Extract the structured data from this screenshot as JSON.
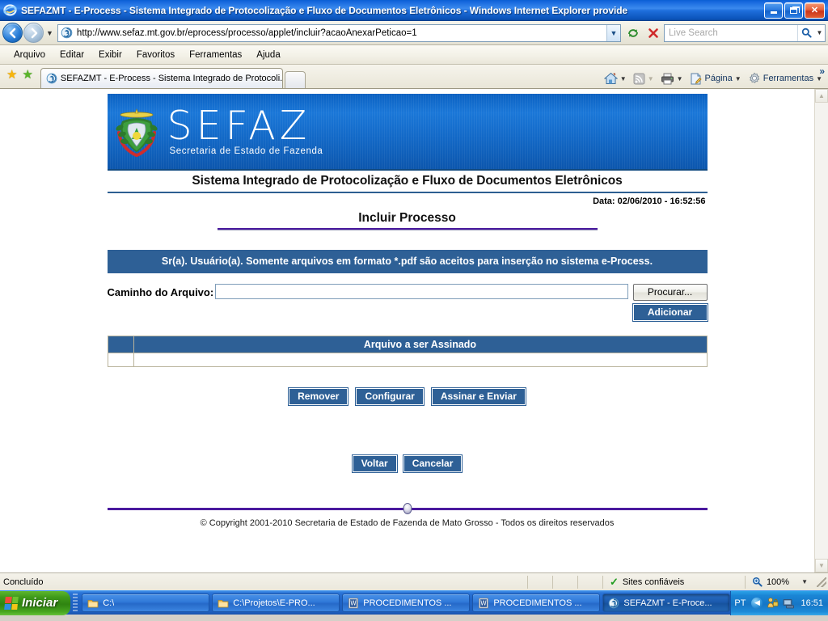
{
  "window": {
    "title": "SEFAZMT - E-Process - Sistema Integrado de Protocolização e Fluxo de Documentos Eletrônicos - Windows Internet Explorer provide",
    "minimize_label": "Minimizar",
    "maximize_label": "Restaurar",
    "close_label": "Fechar"
  },
  "navbar": {
    "back_label": "Voltar",
    "forward_label": "Avançar",
    "url": "http://www.sefaz.mt.gov.br/eprocess/processo/applet/incluir?acaoAnexarPeticao=1",
    "refresh_label": "Atualizar",
    "stop_label": "Parar",
    "search_placeholder": "Live Search",
    "search_value": ""
  },
  "menubar": {
    "items": [
      "Arquivo",
      "Editar",
      "Exibir",
      "Favoritos",
      "Ferramentas",
      "Ajuda"
    ]
  },
  "tabbar": {
    "tab_title": "SEFAZMT - E-Process - Sistema Integrado de Protocoli...",
    "new_tab_label": "Nova Guia",
    "tools": [
      {
        "label": "",
        "icon": "home-icon",
        "has_caret": true
      },
      {
        "label": "",
        "icon": "feeds-icon",
        "has_caret": true
      },
      {
        "label": "",
        "icon": "print-icon",
        "has_caret": true
      },
      {
        "label": "Página",
        "icon": "page-icon",
        "has_caret": true
      },
      {
        "label": "Ferramentas",
        "icon": "gear-icon",
        "has_caret": true
      }
    ],
    "overflow_label": "»"
  },
  "page": {
    "banner": {
      "brand": "SEFAZ",
      "tagline": "Secretaria de Estado de Fazenda",
      "crest_alt": "Brasão do Estado de Mato Grosso"
    },
    "system_title": "Sistema Integrado de Protocolização e Fluxo de Documentos Eletrônicos",
    "date_line": "Data: 02/06/2010 - 16:52:56",
    "page_title": "Incluir Processo",
    "notice": "Sr(a). Usuário(a). Somente arquivos em formato *.pdf são aceitos para inserção no sistema e-Process.",
    "form": {
      "file_path_label": "Caminho do Arquivo:",
      "file_path_value": "",
      "file_path_placeholder": "",
      "browse_label": "Procurar...",
      "add_label": "Adicionar"
    },
    "table": {
      "header_narrow": "",
      "header_main": "Arquivo a ser Assinado",
      "rows": [
        {
          "select": "",
          "filename": ""
        }
      ]
    },
    "actions": {
      "remove_label": "Remover",
      "configure_label": "Configurar",
      "sign_send_label": "Assinar e Enviar"
    },
    "nav_actions": {
      "back_label": "Voltar",
      "cancel_label": "Cancelar"
    },
    "copyright": "© Copyright 2001-2010 Secretaria de Estado de Fazenda de Mato Grosso - Todos os direitos reservados"
  },
  "statusbar": {
    "status": "Concluído",
    "zone": "Sites confiáveis",
    "zoom": "100%"
  },
  "taskbar": {
    "start_label": "Iniciar",
    "tasks": [
      {
        "label": "C:\\",
        "icon": "folder-icon",
        "active": false
      },
      {
        "label": "C:\\Projetos\\E-PRO...",
        "icon": "folder-icon",
        "active": false
      },
      {
        "label": "PROCEDIMENTOS ...",
        "icon": "word-icon",
        "active": false
      },
      {
        "label": "PROCEDIMENTOS ...",
        "icon": "word-icon",
        "active": false
      },
      {
        "label": "SEFAZMT - E-Proce...",
        "icon": "ie-icon",
        "active": true
      }
    ],
    "tray": {
      "language": "PT",
      "clock": "16:51"
    }
  },
  "colors": {
    "brand_blue": "#2e6096",
    "banner_blue": "#1268c6",
    "rule_purple": "#4a1a9e",
    "titlebar_blue": "#1567dd",
    "taskbar_blue": "#1f63c6",
    "start_green": "#3f9a1b"
  }
}
